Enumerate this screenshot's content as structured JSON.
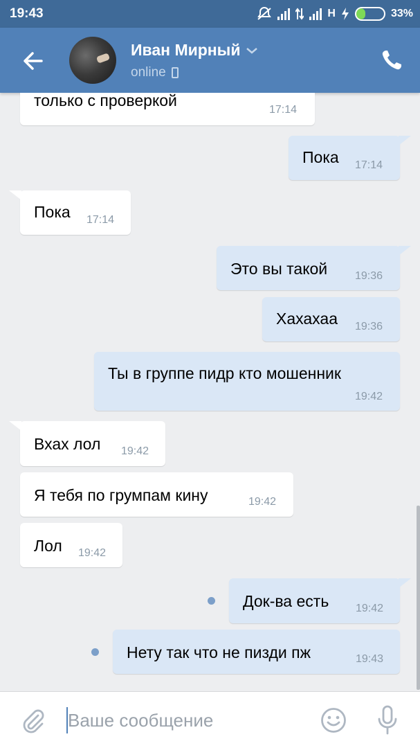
{
  "status_bar": {
    "time": "19:43",
    "network": "H",
    "battery_percent": "33%",
    "battery_level": 0.33
  },
  "header": {
    "contact_name": "Иван Мирный",
    "contact_status": "online"
  },
  "messages": [
    {
      "dir": "in",
      "text": "только с проверкой",
      "time": "17:14"
    },
    {
      "dir": "out",
      "text": "Пока",
      "time": "17:14"
    },
    {
      "dir": "in",
      "text": "Пока",
      "time": "17:14"
    },
    {
      "dir": "out",
      "text": "Это вы такой",
      "time": "19:36"
    },
    {
      "dir": "out",
      "text": "Хахахаа",
      "time": "19:36"
    },
    {
      "dir": "out",
      "text": "Ты в группе пидр кто мошенник",
      "time": "19:42"
    },
    {
      "dir": "in",
      "text": "Вхах лол",
      "time": "19:42"
    },
    {
      "dir": "in",
      "text": "Я тебя по грумпам кину",
      "time": "19:42"
    },
    {
      "dir": "in",
      "text": "Лол",
      "time": "19:42"
    },
    {
      "dir": "out",
      "text": "Док-ва есть",
      "time": "19:42",
      "unread": true
    },
    {
      "dir": "out",
      "text": "Нету так что не пизди пж",
      "time": "19:43",
      "unread": true
    }
  ],
  "composer": {
    "placeholder": "Ваше сообщение",
    "value": ""
  },
  "icons": {
    "back": "arrow-left-icon",
    "call": "phone-icon",
    "attach": "paperclip-icon",
    "emoji": "smile-icon",
    "voice": "microphone-icon"
  },
  "colors": {
    "status_bar": "#3f6a98",
    "header": "#5181b8",
    "background": "#edeef0",
    "incoming_bubble": "#ffffff",
    "outgoing_bubble": "#dae7f6",
    "time_text": "#8b9aa8",
    "unread_dot": "#7c9fc9"
  }
}
